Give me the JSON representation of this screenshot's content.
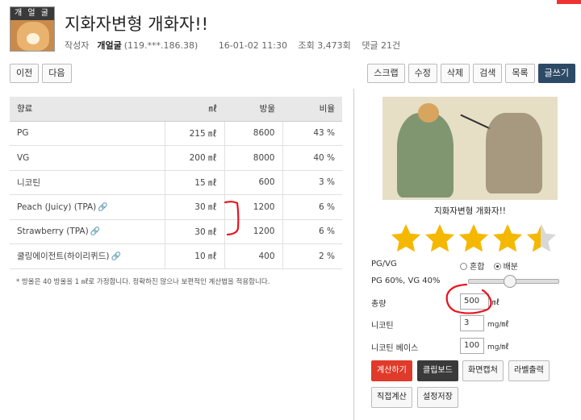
{
  "header": {
    "avatar_name": "개 얼 굴",
    "title": "지화자변형 개화자!!",
    "author_label": "작성자",
    "author_name": "개얼굴",
    "author_ip": "(119.***.186.38)",
    "date": "16-01-02 11:30",
    "views": "조회 3,473회",
    "comments": "댓글 21건"
  },
  "nav": {
    "prev": "이전",
    "next": "다음",
    "scrap": "스크랩",
    "edit": "수정",
    "delete": "삭제",
    "search": "검색",
    "list": "목록",
    "write": "글쓰기"
  },
  "table": {
    "headers": [
      "향료",
      "㎖",
      "방울",
      "비율"
    ],
    "rows": [
      {
        "name": "PG",
        "ml": "215 ㎖",
        "drops": "8600",
        "ratio": "43 %"
      },
      {
        "name": "VG",
        "ml": "200 ㎖",
        "drops": "8000",
        "ratio": "40 %"
      },
      {
        "name": "니코틴",
        "ml": "15 ㎖",
        "drops": "600",
        "ratio": "3 %"
      },
      {
        "name": "Peach (Juicy) (TPA)",
        "ml": "30 ㎖",
        "drops": "1200",
        "ratio": "6 %"
      },
      {
        "name": "Strawberry (TPA)",
        "ml": "30 ㎖",
        "drops": "1200",
        "ratio": "6 %"
      },
      {
        "name": "쿨링에이전트(하이리퀴드)",
        "ml": "10 ㎖",
        "drops": "400",
        "ratio": "2 %"
      }
    ],
    "note": "* 방울은 40 방울을 1 ㎖로 가정합니다. 정확하진 않으나 보편적인 계산법을 적용합니다."
  },
  "recipe": {
    "caption": "지화자변형 개화자!!",
    "rating": 4.5
  },
  "calc": {
    "pgvg_label": "PG/VG",
    "opt_mix": "혼합",
    "opt_dist": "배분",
    "pgvg_value": "PG 60%, VG 40%",
    "pg_percent": 60,
    "amount_label": "총량",
    "amount_value": "500",
    "amount_unit": "㎖",
    "nic_label": "니코틴",
    "nic_value": "3",
    "nic_unit": "mg/㎖",
    "base_label": "니코틴 베이스",
    "base_value": "100",
    "base_unit": "mg/㎖"
  },
  "actions": {
    "calculate": "계산하기",
    "clipboard": "클립보드",
    "capture": "화면캡처",
    "label_print": "라벨출력",
    "direct_calc": "직접계산",
    "save_settings": "설정저장"
  },
  "colors": {
    "accent_dark": "#2c4a66",
    "calc_red": "#e03a2a",
    "star": "#f5b800",
    "annotation_red": "#e8141f"
  }
}
